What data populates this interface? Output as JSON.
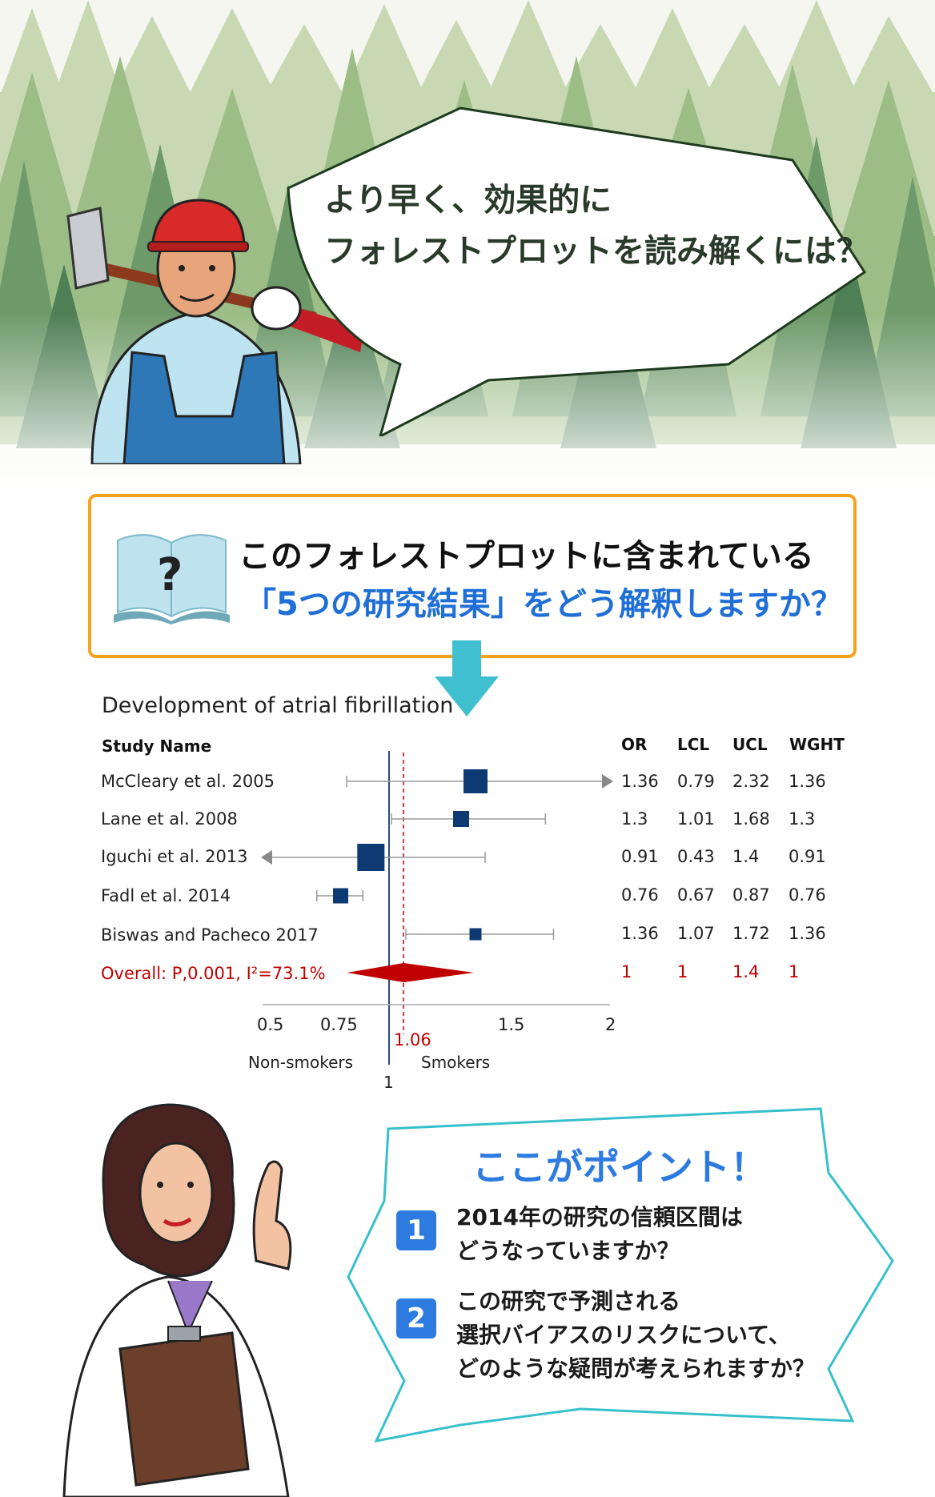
{
  "header": {
    "title_line1": "より早く、効果的に",
    "title_line2": "フォレストプロットを読み解くには？"
  },
  "question": {
    "line1": "このフォレストプロットに含まれている",
    "line2": "「5つの研究結果」をどう解釈しますか？",
    "book_symbol": "?"
  },
  "chart_data": {
    "type": "forest",
    "title": "Development of atrial fibrillation",
    "columns": {
      "study": "Study Name",
      "or": "OR",
      "lcl": "LCL",
      "ucl": "UCL",
      "wght": "WGHT"
    },
    "studies": [
      {
        "name": "McCleary et al. 2005",
        "or": 1.36,
        "lcl": 0.79,
        "ucl": 2.32,
        "wght": 1.36,
        "or_text": "1.36",
        "lcl_text": "0.79",
        "ucl_text": "2.32",
        "wght_text": "1.36",
        "arrow_right": true
      },
      {
        "name": "Lane et al. 2008",
        "or": 1.3,
        "lcl": 1.01,
        "ucl": 1.68,
        "wght": 1.3,
        "or_text": "1.3",
        "lcl_text": "1.01",
        "ucl_text": "1.68",
        "wght_text": "1.3"
      },
      {
        "name": "Iguchi et al. 2013",
        "or": 0.91,
        "lcl": 0.43,
        "ucl": 1.4,
        "wght": 0.91,
        "or_text": "0.91",
        "lcl_text": "0.43",
        "ucl_text": "1.4",
        "wght_text": "0.91",
        "arrow_left": true
      },
      {
        "name": "Fadl et al. 2014",
        "or": 0.76,
        "lcl": 0.67,
        "ucl": 0.87,
        "wght": 0.76,
        "or_text": "0.76",
        "lcl_text": "0.67",
        "ucl_text": "0.87",
        "wght_text": "0.76"
      },
      {
        "name": "Biswas and Pacheco 2017",
        "or": 1.36,
        "lcl": 1.07,
        "ucl": 1.72,
        "wght": 1.36,
        "or_text": "1.36",
        "lcl_text": "1.07",
        "ucl_text": "1.72",
        "wght_text": "1.36"
      }
    ],
    "overall": {
      "name": "Overall: P,0.001, I²=73.1%",
      "or": 1.06,
      "lcl": 0.91,
      "ucl": 1.22,
      "or_text": "1",
      "lcl_text": "1",
      "ucl_text": "1.4",
      "wght_text": "1"
    },
    "x_ticks": [
      "0.5",
      "0.75",
      "1.5",
      "2"
    ],
    "x_tick_values": [
      0.5,
      0.75,
      1.5,
      2
    ],
    "reference_line": 1,
    "reference_label": "1",
    "pooled_line": 1.06,
    "pooled_label": "1.06",
    "left_label": "Non-smokers",
    "right_label": "Smokers",
    "colors": {
      "square": "#0d3a72",
      "pooled": "#c00000",
      "ci": "#999999",
      "ref": "#2b4d7a"
    }
  },
  "points": {
    "title": "ここがポイント！",
    "items": [
      {
        "num": "1",
        "lines": [
          "2014年の研究の信頼区間は",
          "どうなっていますか？"
        ]
      },
      {
        "num": "2",
        "lines": [
          "この研究で予測される",
          "選択バイアスのリスクについて、",
          "どのような疑問が考えられますか？"
        ]
      }
    ]
  }
}
